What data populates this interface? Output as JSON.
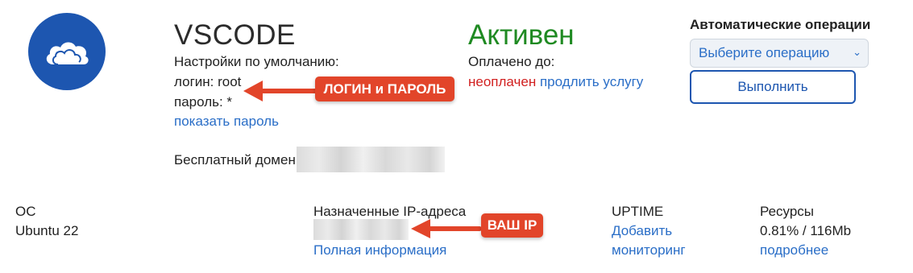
{
  "service": {
    "name": "VSCODE",
    "defaults_label": "Настройки по умолчанию:",
    "login_line": "логин: root",
    "password_line": "пароль: *",
    "show_password": "показать пароль",
    "free_domain_label": "Бесплатный домен"
  },
  "status": {
    "state": "Активен",
    "paid_until_label": "Оплачено до:",
    "unpaid": "неоплачен",
    "extend": "продлить услугу"
  },
  "operations": {
    "label": "Автоматические операции",
    "select_value": "Выберите операцию",
    "run_button": "Выполнить"
  },
  "annotations": {
    "login_password_badge": "ЛОГИН и ПАРОЛЬ",
    "ip_badge": "ВАШ IP"
  },
  "info": {
    "os_label": "ОС",
    "os_value": "Ubuntu 22",
    "ip_label": "Назначенные IP-адреса",
    "ip_details": "Полная информация",
    "uptime_label": "UPTIME",
    "uptime_add": "Добавить",
    "uptime_monitoring": "мониторинг",
    "resources_label": "Ресурсы",
    "resources_value": "0.81% / 116Mb",
    "resources_more": "подробнее"
  },
  "colors": {
    "brand_blue": "#1d56b0",
    "active_green": "#1f8a22",
    "link_blue": "#2a6ec7",
    "unpaid_red": "#d11f1f",
    "badge_orange": "#e2452a"
  },
  "icons": {
    "logo": "cloud-icon",
    "arrow": "arrow-left-icon",
    "select": "chevron-down-icon"
  }
}
